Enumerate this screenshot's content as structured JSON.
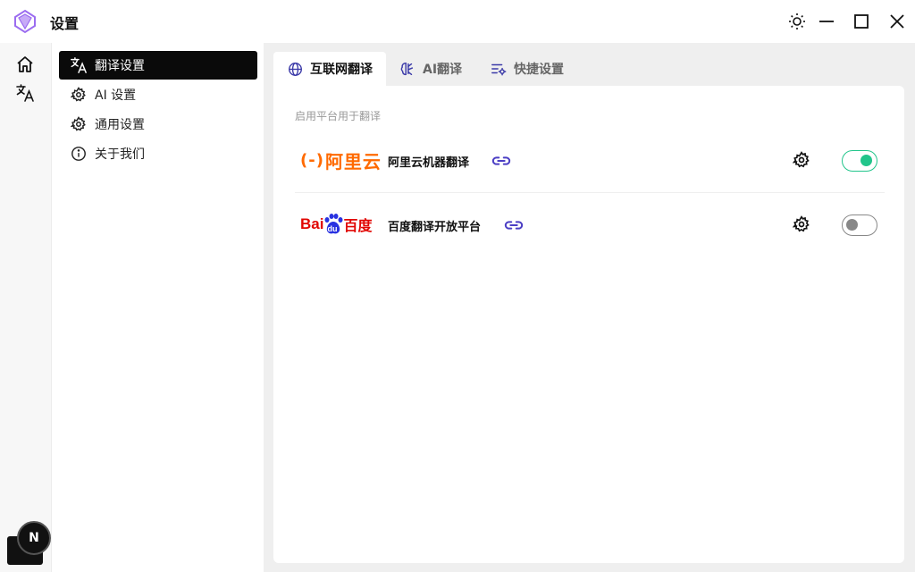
{
  "window": {
    "title": "设置"
  },
  "rail": {
    "avatar_letter": "N"
  },
  "sidebar": {
    "items": [
      {
        "label": "翻译设置",
        "icon": "translate-icon",
        "active": true
      },
      {
        "label": "AI 设置",
        "icon": "gear-icon",
        "active": false
      },
      {
        "label": "通用设置",
        "icon": "gear-icon",
        "active": false
      },
      {
        "label": "关于我们",
        "icon": "info-icon",
        "active": false
      }
    ]
  },
  "tabs": [
    {
      "label": "互联网翻译",
      "icon": "globe-icon",
      "active": true
    },
    {
      "label": "AI翻译",
      "icon": "brain-icon",
      "active": false
    },
    {
      "label": "快捷设置",
      "icon": "settings-list-icon",
      "active": false
    }
  ],
  "panel": {
    "hint": "启用平台用于翻译",
    "providers": [
      {
        "logo_text": "阿里云",
        "logo_brand": "(-)",
        "name": "阿里云机器翻译",
        "enabled": true
      },
      {
        "logo_text": "百度",
        "logo_brand": "Bai",
        "logo_mark": "du",
        "name": "百度翻译开放平台",
        "enabled": false
      }
    ]
  },
  "colors": {
    "accent_on": "#22c58b",
    "aliyun_orange": "#ff6a00",
    "baidu_red": "#e10602",
    "baidu_blue": "#2932e1",
    "link_purple": "#4b3ec4"
  }
}
